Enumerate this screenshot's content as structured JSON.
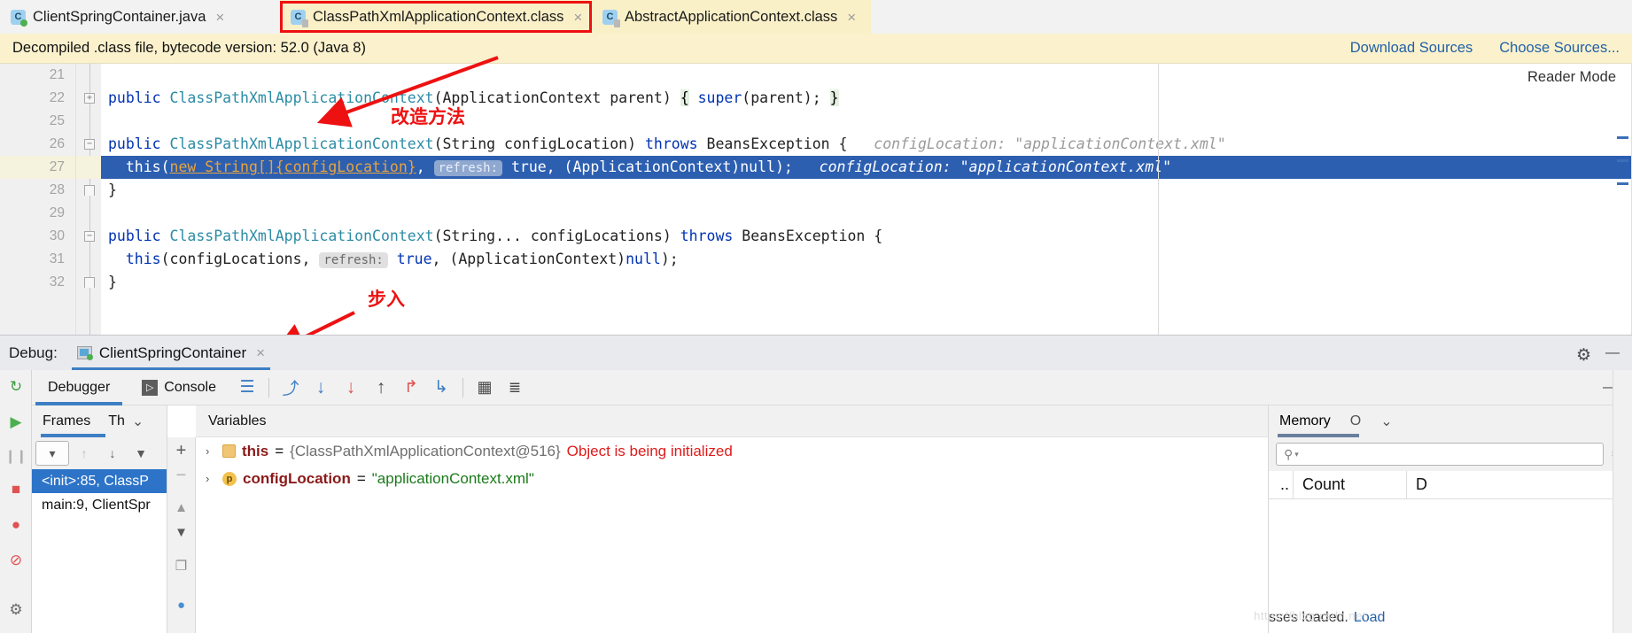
{
  "editor_tabs": [
    {
      "label": "ClientSpringContainer.java",
      "icon": "java-class-icon",
      "selected": false,
      "highlighted": false
    },
    {
      "label": "ClassPathXmlApplicationContext.class",
      "icon": "compiled-class-icon",
      "selected": true,
      "highlighted": true
    },
    {
      "label": "AbstractApplicationContext.class",
      "icon": "compiled-class-icon",
      "selected": false,
      "highlighted": false
    }
  ],
  "tab_close_glyph": "×",
  "banner": {
    "text": "Decompiled .class file, bytecode version: 52.0 (Java 8)",
    "download_sources": "Download Sources",
    "choose_sources": "Choose Sources..."
  },
  "editor": {
    "reader_mode": "Reader Mode",
    "lines": [
      {
        "num": "21",
        "fold": "",
        "tokens": []
      },
      {
        "num": "22",
        "fold": "+",
        "tokens": [
          {
            "t": "public",
            "c": "kw"
          },
          {
            "t": " ",
            "c": "plain"
          },
          {
            "t": "ClassPathXmlApplicationContext",
            "c": "type"
          },
          {
            "t": "(ApplicationContext parent) ",
            "c": "plain"
          },
          {
            "t": "{",
            "c": "brace"
          },
          {
            "t": " ",
            "c": "plain"
          },
          {
            "t": "super",
            "c": "kw"
          },
          {
            "t": "(parent); ",
            "c": "plain"
          },
          {
            "t": "}",
            "c": "brace"
          }
        ]
      },
      {
        "num": "25",
        "fold": "",
        "tokens": []
      },
      {
        "num": "26",
        "fold": "-",
        "tokens": [
          {
            "t": "public",
            "c": "kw"
          },
          {
            "t": " ",
            "c": "plain"
          },
          {
            "t": "ClassPathXmlApplicationContext",
            "c": "type"
          },
          {
            "t": "(String configLocation) ",
            "c": "plain"
          },
          {
            "t": "throws",
            "c": "kw"
          },
          {
            "t": " BeansException {",
            "c": "plain"
          },
          {
            "t": "   configLocation: \"applicationContext.xml\"",
            "c": "hint"
          }
        ]
      },
      {
        "num": "27",
        "fold": "",
        "highlight": true,
        "tokens": [
          {
            "t": "  this(",
            "c": "plain"
          },
          {
            "t": "new String[]{configLocation}",
            "c": "ul"
          },
          {
            "t": ", ",
            "c": "plain"
          },
          {
            "t": "refresh:",
            "c": "param"
          },
          {
            "t": " true, (ApplicationContext)null);",
            "c": "plain"
          },
          {
            "t": "   configLocation: \"applicationContext.xml\"",
            "c": "hint"
          }
        ]
      },
      {
        "num": "28",
        "fold": "^",
        "tokens": [
          {
            "t": "}",
            "c": "plain"
          }
        ]
      },
      {
        "num": "29",
        "fold": "",
        "tokens": []
      },
      {
        "num": "30",
        "fold": "-",
        "tokens": [
          {
            "t": "public",
            "c": "kw"
          },
          {
            "t": " ",
            "c": "plain"
          },
          {
            "t": "ClassPathXmlApplicationContext",
            "c": "type"
          },
          {
            "t": "(String... configLocations) ",
            "c": "plain"
          },
          {
            "t": "throws",
            "c": "kw"
          },
          {
            "t": " BeansException {",
            "c": "plain"
          }
        ]
      },
      {
        "num": "31",
        "fold": "",
        "tokens": [
          {
            "t": "  this",
            "c": "kw"
          },
          {
            "t": "(configLocations, ",
            "c": "plain"
          },
          {
            "t": "refresh:",
            "c": "param"
          },
          {
            "t": " ",
            "c": "plain"
          },
          {
            "t": "true",
            "c": "kw"
          },
          {
            "t": ", (ApplicationContext)",
            "c": "plain"
          },
          {
            "t": "null",
            "c": "kw"
          },
          {
            "t": ");",
            "c": "plain"
          }
        ]
      },
      {
        "num": "32",
        "fold": "^",
        "tokens": [
          {
            "t": "}",
            "c": "plain"
          }
        ]
      }
    ]
  },
  "annotations": [
    {
      "text": "改造方法",
      "name": "annotation-modify-method"
    },
    {
      "text": "步入",
      "name": "annotation-step-into"
    }
  ],
  "debug": {
    "label": "Debug:",
    "session_tab": "ClientSpringContainer",
    "session_close": "×",
    "settings_icon": "⚙",
    "minimize_icon": "—",
    "tabs": [
      {
        "label": "Debugger",
        "active": true
      },
      {
        "label": "Console",
        "active": false
      }
    ],
    "toolbar_icons": [
      {
        "name": "show-execution-point-icon",
        "glyph": "⤴"
      },
      {
        "name": "step-over-icon",
        "glyph": "↓"
      },
      {
        "name": "step-into-icon",
        "glyph": "↓"
      },
      {
        "name": "step-out-icon",
        "glyph": "↑"
      },
      {
        "name": "force-step-into-icon",
        "glyph": "↱"
      },
      {
        "name": "run-to-cursor-icon",
        "glyph": "↳"
      },
      {
        "name": "evaluate-expression-icon",
        "glyph": "▦"
      },
      {
        "name": "layout-settings-icon",
        "glyph": "☰"
      }
    ],
    "left_actions": [
      {
        "name": "rerun-button",
        "glyph": "↻",
        "color": "#3f9c42"
      },
      {
        "name": "resume-program-button",
        "glyph": "▶",
        "color": "#4caf50"
      },
      {
        "name": "pause-program-button",
        "glyph": "❙❙",
        "color": "#b0b0b0"
      },
      {
        "name": "stop-button",
        "glyph": "■",
        "color": "#e05252"
      },
      {
        "name": "view-breakpoints-button",
        "glyph": "●",
        "color": "#e05252"
      },
      {
        "name": "mute-breakpoints-button",
        "glyph": "⊘",
        "color": "#e05252"
      },
      {
        "name": "settings-button",
        "glyph": "⚙",
        "color": "#6a6a6a"
      }
    ],
    "frames": {
      "tab_label": "Frames",
      "threads_label": "Th",
      "dropdown_glyph": "⌄",
      "tools": [
        {
          "name": "thread-selector",
          "glyph": "▾"
        },
        {
          "name": "frames-up-button",
          "glyph": "↑"
        },
        {
          "name": "frames-down-button",
          "glyph": "↓"
        },
        {
          "name": "frames-filter-button",
          "glyph": "▼"
        }
      ],
      "items": [
        {
          "label": "<init>:85, ClassP",
          "selected": true
        },
        {
          "label": "main:9, ClientSpr",
          "selected": false
        }
      ],
      "side_tools": [
        {
          "name": "add-watch-button",
          "glyph": "+"
        },
        {
          "name": "remove-watch-button",
          "glyph": "−"
        },
        {
          "name": "scroll-up-button",
          "glyph": "▲"
        },
        {
          "name": "scroll-down-button",
          "glyph": "▼"
        },
        {
          "name": "copy-button",
          "glyph": "❐"
        },
        {
          "name": "more-button",
          "glyph": "●"
        }
      ]
    },
    "variables": {
      "title": "Variables",
      "rows": [
        {
          "twisty": "›",
          "icon": "object-variable-icon",
          "name": "this",
          "eq": "=",
          "value": "{ClassPathXmlApplicationContext@516}",
          "note": "Object is being initialized"
        },
        {
          "twisty": "›",
          "icon": "parameter-variable-icon",
          "icon_letter": "p",
          "name": "configLocation",
          "eq": "=",
          "value": "\"applicationContext.xml\"",
          "note": ""
        }
      ]
    },
    "memory": {
      "tab_label": "Memory",
      "overhead_label": "O",
      "dropdown_glyph": "⌄",
      "search_placeholder": "",
      "search_icon": "⚲",
      "gear_icon": "⚙",
      "columns": [
        "..",
        "Count",
        "D"
      ],
      "status_text": "sses loaded.",
      "status_link": "Load"
    }
  },
  "colors": {
    "accent_blue": "#2d74c8",
    "tab_highlight": "#faf0c8",
    "annotation_red": "#ee1111",
    "keyword_blue": "#0033b3",
    "type_teal": "#2c8ca6",
    "selected_line": "#2d5fb1"
  }
}
